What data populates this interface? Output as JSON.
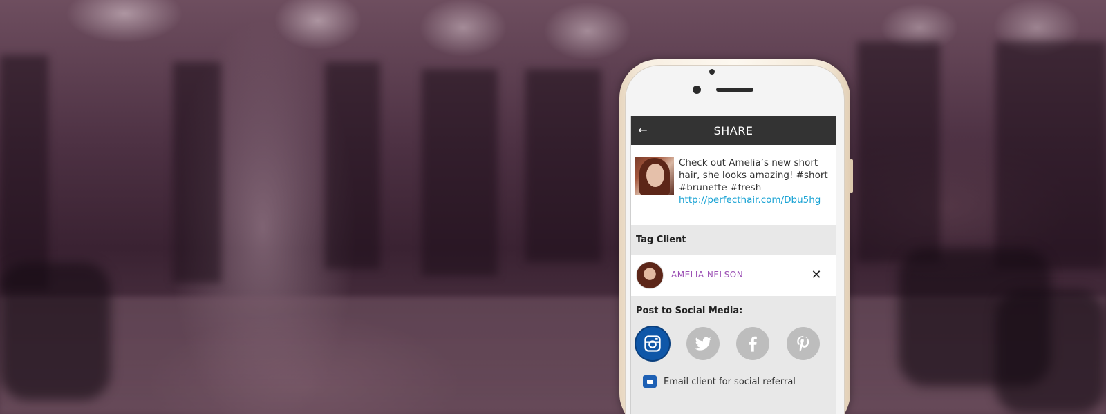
{
  "screen": {
    "title": "SHARE",
    "back_icon": "arrow-left-icon"
  },
  "post": {
    "text": "Check out Amelia’s new short hair, she looks amazing! #short #brunette #fresh",
    "link": "http://perfecthair.com/Dbu5hg"
  },
  "tag_client": {
    "label": "Tag Client",
    "client_name": "AMELIA NELSON",
    "remove_icon": "close-icon"
  },
  "social": {
    "label": "Post to Social Media:",
    "networks": [
      {
        "name": "instagram",
        "icon": "instagram-icon",
        "selected": true
      },
      {
        "name": "twitter",
        "icon": "twitter-icon",
        "selected": false
      },
      {
        "name": "facebook",
        "icon": "facebook-icon",
        "selected": false
      },
      {
        "name": "pinterest",
        "icon": "pinterest-icon",
        "selected": false
      }
    ]
  },
  "email_referral": {
    "label": "Email client for social referral",
    "checked": true
  },
  "colors": {
    "topbar": "#333333",
    "link": "#1aa3d4",
    "client_name": "#9b4fb4",
    "instagram_active": "#0f57a8",
    "inactive_social": "#bdbdbd",
    "background_overlay": "#4a2f3e"
  }
}
